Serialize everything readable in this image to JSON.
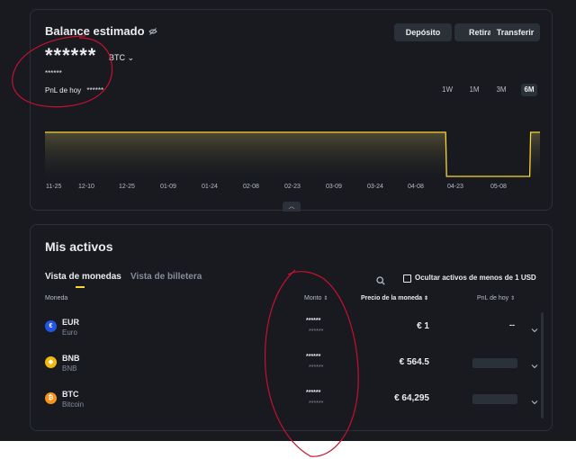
{
  "balance": {
    "title": "Balance estimado",
    "hidden_value": "******",
    "currency": "BTC",
    "hidden_fiat": "******",
    "pnl_label": "PnL de hoy",
    "pnl_value": "******"
  },
  "actions": {
    "deposit": "Depósito",
    "withdraw": "Retirar",
    "transfer": "Transferir"
  },
  "ranges": [
    "1W",
    "1M",
    "3M",
    "6M"
  ],
  "active_range": "6M",
  "chart_data": {
    "type": "area",
    "x_ticks": [
      "11-25",
      "12-10",
      "12-25",
      "01-09",
      "01-24",
      "02-08",
      "02-23",
      "03-09",
      "03-24",
      "04-08",
      "04-23",
      "05-08"
    ],
    "series": [
      {
        "values": [
          1,
          1,
          1,
          1,
          1,
          1,
          1,
          1,
          1,
          1,
          1,
          1,
          1,
          1,
          1,
          1,
          1,
          1,
          1,
          1,
          1,
          1,
          1,
          1,
          1,
          1,
          1,
          1,
          1,
          1,
          1,
          1,
          1,
          1,
          1,
          1,
          1,
          1,
          1,
          1,
          1,
          1,
          1,
          0,
          0,
          0,
          0,
          0,
          0,
          0,
          0,
          0,
          1,
          1
        ]
      }
    ],
    "line_color": "#fcd535",
    "grid": false
  },
  "assets": {
    "title": "Mis activos",
    "tabs": [
      "Vista de monedas",
      "Vista de billetera"
    ],
    "hide_small_label": "Ocultar activos de menos de 1 USD",
    "columns": {
      "coin": "Moneda",
      "amount": "Monto",
      "price": "Precio de la moneda",
      "pnl": "PnL de hoy"
    },
    "rows": [
      {
        "symbol": "EUR",
        "name": "Euro",
        "amount": "******",
        "amount_fiat": "******",
        "price": "€ 1",
        "pnl": "--",
        "icon": "euro-icon",
        "color": "#2354e6",
        "glyph": "€"
      },
      {
        "symbol": "BNB",
        "name": "BNB",
        "amount": "******",
        "amount_fiat": "******",
        "price": "€ 564.5",
        "pnl": "",
        "icon": "bnb-icon",
        "color": "#f0b90b",
        "glyph": "◆"
      },
      {
        "symbol": "BTC",
        "name": "Bitcoin",
        "amount": "******",
        "amount_fiat": "******",
        "price": "€ 64,295",
        "pnl": "",
        "icon": "bitcoin-icon",
        "color": "#f7931a",
        "glyph": "₿"
      }
    ]
  }
}
